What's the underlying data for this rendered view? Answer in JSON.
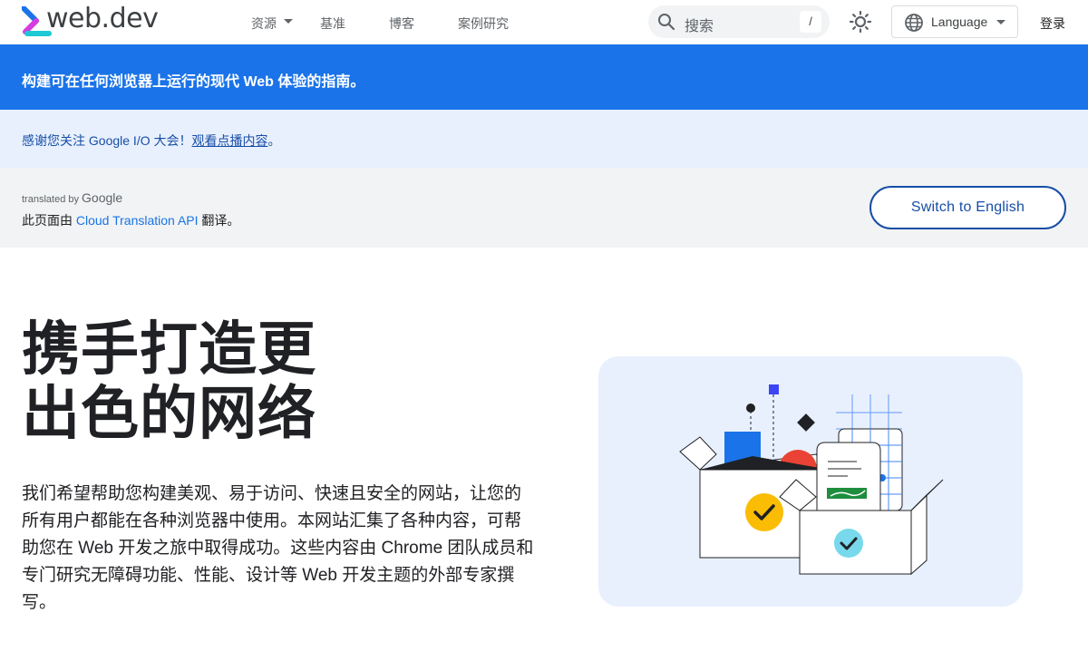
{
  "header": {
    "logo_text": "web.dev",
    "nav": [
      {
        "label": "资源",
        "has_dropdown": true
      },
      {
        "label": "基准",
        "has_dropdown": false
      },
      {
        "label": "博客",
        "has_dropdown": false
      },
      {
        "label": "案例研究",
        "has_dropdown": false
      }
    ],
    "search_placeholder": "搜索",
    "search_shortcut": "/",
    "language_label": "Language",
    "signin_label": "登录"
  },
  "banner": {
    "text": "构建可在任何浏览器上运行的现代 Web 体验的指南。"
  },
  "announcement": {
    "text": "感谢您关注 Google I/O 大会！",
    "link": "观看点播内容",
    "suffix": "。"
  },
  "translation": {
    "translated_by": "translated by",
    "google": "Google",
    "prefix": "此页面由",
    "api": "Cloud Translation API",
    "suffix": "翻译。",
    "switch_label": "Switch to English"
  },
  "hero": {
    "title_line1": "携手打造更",
    "title_line2": "出色的网络",
    "description": "我们希望帮助您构建美观、易于访问、快速且安全的网站，让您的所有用户都能在各种浏览器中使用。本网站汇集了各种内容，可帮助您在 Web 开发之旅中取得成功。这些内容由 Chrome 团队成员和专门研究无障碍功能、性能、设计等 Web 开发主题的外部专家撰写。"
  },
  "colors": {
    "brand_blue": "#1a73e8",
    "announce_bg": "#e8f0fe",
    "translate_bg": "#f1f3f4",
    "link_dark": "#174ea6"
  }
}
